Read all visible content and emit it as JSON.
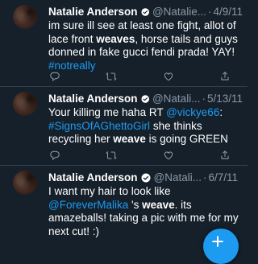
{
  "tweets": [
    {
      "name": "Natalie Anderson",
      "handle": "@Natalie...",
      "sep": "·",
      "date": "4/9/11",
      "text": {
        "p1": "im sure ill see at least one fight, allot of lace front ",
        "p2": "weaves",
        "p3": ", horse tails and guys donned in fake gucci fendi prada! YAY! ",
        "p4": "#notreally"
      }
    },
    {
      "name": "Natalie Anderson",
      "handle": "@Natali...",
      "sep": "·",
      "date": "5/13/11",
      "text": {
        "p1": "Your killing me haha RT ",
        "p2": "@vickye66",
        "p3": ": ",
        "p4": "#SignsOfAGhettoGirl",
        "p5": " she thinks recycling her ",
        "p6": "weave",
        "p7": " is going GREEN"
      }
    },
    {
      "name": "Natalie Anderson",
      "handle": "@Natali...",
      "sep": "·",
      "date": "6/7/11",
      "text": {
        "p1": "I want my hair to look like ",
        "p2": "@ForeverMalika",
        "p3": " 's ",
        "p4": "weave",
        "p5": ". its amazeballs! taking a pic with me for my next cut! :)"
      }
    }
  ],
  "icons": {
    "verified": "verified-badge-icon",
    "reply": "reply-icon",
    "retweet": "retweet-icon",
    "like": "like-icon",
    "share": "share-icon",
    "compose": "compose-tweet-icon"
  },
  "colors": {
    "background": "#15202b",
    "link": "#1d9bf0",
    "muted": "#8b98a5",
    "divider": "#2f3f4f"
  }
}
